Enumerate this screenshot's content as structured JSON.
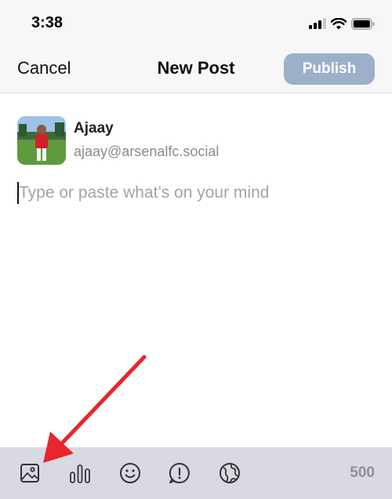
{
  "status_bar": {
    "time": "3:38"
  },
  "header": {
    "cancel_label": "Cancel",
    "title": "New Post",
    "publish_label": "Publish"
  },
  "author": {
    "name": "Ajaay",
    "handle": "ajaay@arsenalfc.social"
  },
  "composer": {
    "placeholder": "Type or paste what’s on your mind",
    "value": ""
  },
  "toolbar": {
    "icons": [
      "image-icon",
      "poll-icon",
      "emoji-icon",
      "content-warning-icon",
      "visibility-globe-icon"
    ],
    "char_remaining": "500"
  },
  "colors": {
    "publish_disabled": "#9db0c9",
    "toolbar_bg": "#d9d9e3",
    "annotation_arrow": "#e8262d"
  }
}
